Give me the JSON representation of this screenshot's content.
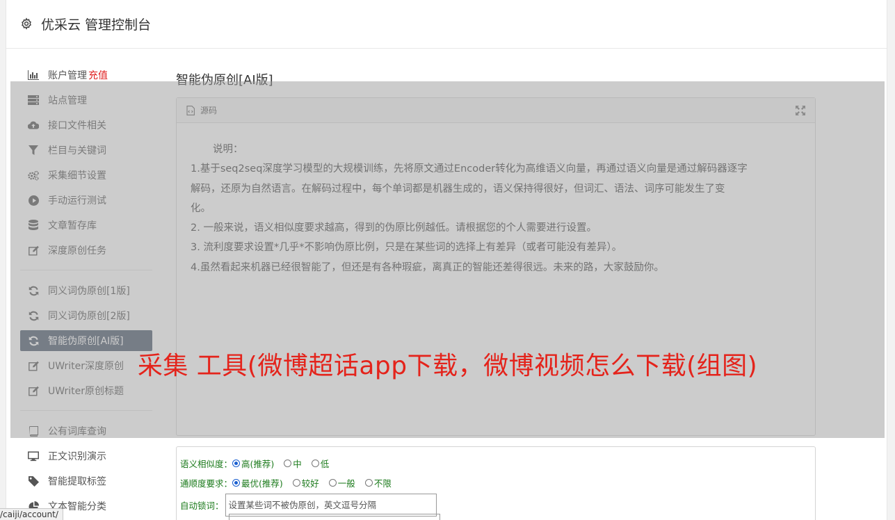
{
  "header": {
    "title": "优采云 管理控制台"
  },
  "sidebar": {
    "group1": [
      {
        "label": "账户管理",
        "extra": "充值",
        "icon": "bar-chart-icon"
      },
      {
        "label": "站点管理",
        "icon": "server-icon"
      },
      {
        "label": "接口文件相关",
        "icon": "cloud-upload-icon"
      },
      {
        "label": "栏目与关键词",
        "icon": "filter-icon"
      },
      {
        "label": "采集细节设置",
        "icon": "cogs-icon"
      },
      {
        "label": "手动运行测试",
        "icon": "play-circle-icon"
      },
      {
        "label": "文章暂存库",
        "icon": "database-icon"
      },
      {
        "label": "深度原创任务",
        "icon": "edit-icon"
      }
    ],
    "group2": [
      {
        "label": "同义词伪原创[1版]",
        "icon": "refresh-icon"
      },
      {
        "label": "同义词伪原创[2版]",
        "icon": "refresh-icon"
      },
      {
        "label": "智能伪原创[AI版]",
        "icon": "refresh-icon",
        "active": true
      },
      {
        "label": "UWriter深度原创",
        "icon": "edit-icon"
      },
      {
        "label": "UWriter原创标题",
        "icon": "edit-icon"
      }
    ],
    "group3": [
      {
        "label": "公有词库查询",
        "icon": "book-icon"
      },
      {
        "label": "正文识别演示",
        "icon": "monitor-icon"
      },
      {
        "label": "智能提取标签",
        "icon": "tag-icon"
      },
      {
        "label": "文本智能分类",
        "icon": "pie-chart-icon"
      }
    ]
  },
  "main": {
    "title": "智能伪原创[AI版]",
    "panel_title": "源码",
    "desc_heading": "说明：",
    "desc_lines": [
      "1.基于seq2seq深度学习模型的大规模训练，先将原文通过Encoder转化为高维语义向量，再通过语义向量是通过解码器逐字",
      "解码，还原为自然语言。在解码过程中，每个单词都是机器生成的，语义保持得很好，但词汇、语法、词序可能发生了变",
      "化。",
      "2. 一般来说，语义相似度要求越高，得到的伪原比例越低。请根据您的个人需要进行设置。",
      "3. 流利度要求设置*几乎*不影响伪原比例，只是在某些词的选择上有差异（或者可能没有差异）。",
      "4.虽然看起来机器已经很智能了，但还是有各种瑕疵，离真正的智能还差得很远。未来的路，大家鼓励你。"
    ]
  },
  "form": {
    "similarity_label": "语义相似度：",
    "similarity_options": [
      "高(推荐)",
      "中",
      "低"
    ],
    "fluency_label": "通顺度要求：",
    "fluency_options": [
      "最优(推荐)",
      "较好",
      "一般",
      "不限"
    ],
    "lock_label": "自动锁词：",
    "lock_placeholder": "设置某些词不被伪原创，英文逗号分隔"
  },
  "overlay_headline": "采集 工具(微博超话app下载，微博视频怎么下载(组图)",
  "statusbar": {
    "url": "/caiji/account/"
  }
}
